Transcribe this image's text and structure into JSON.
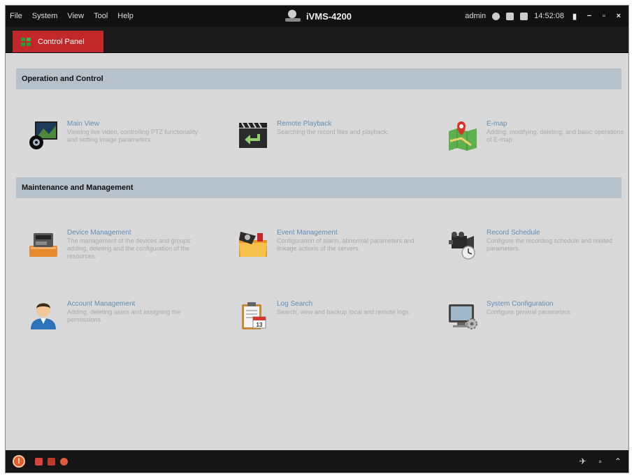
{
  "menu": [
    "File",
    "System",
    "View",
    "Tool",
    "Help"
  ],
  "app": {
    "title": "iVMS-4200"
  },
  "status": {
    "user": "admin",
    "time": "14:52:08"
  },
  "window_buttons": {
    "lock": "▮",
    "minimize": "−",
    "maximize": "▫",
    "close": "×"
  },
  "tab": {
    "label": "Control Panel"
  },
  "sections": [
    {
      "title": "Operation and Control"
    },
    {
      "title": "Maintenance and Management"
    }
  ],
  "modules": [
    {
      "title": "Main View",
      "desc": "Viewing live video, controlling PTZ functionality and setting image parameters",
      "icon": "main-view-icon"
    },
    {
      "title": "Remote Playback",
      "desc": "Searching the record files and playback.",
      "icon": "remote-playback-icon"
    },
    {
      "title": "E-map",
      "desc": "Adding, modifying, deleting, and basic operations of E-map.",
      "icon": "emap-icon"
    },
    {
      "title": "Device Management",
      "desc": "The management of the devices and groups: adding, deleting and the configuration of the resources.",
      "icon": "device-management-icon"
    },
    {
      "title": "Event Management",
      "desc": "Configuration of alarm, abnormal parameters and linkage actions of the servers.",
      "icon": "event-management-icon"
    },
    {
      "title": "Record Schedule",
      "desc": "Configure the recording schedule and related parameters.",
      "icon": "record-schedule-icon"
    },
    {
      "title": "Account Management",
      "desc": "Adding, deleting users and assigning the permissions.",
      "icon": "account-management-icon"
    },
    {
      "title": "Log Search",
      "desc": "Search, view and backup local and remote logs.",
      "icon": "log-search-icon",
      "badge": "13"
    },
    {
      "title": "System Configuration",
      "desc": "Configure general parameters.",
      "icon": "system-configuration-icon"
    }
  ],
  "bottom": {
    "alarm_label": "!",
    "pin": "✈",
    "restore": "▫",
    "expand": "⌃"
  }
}
